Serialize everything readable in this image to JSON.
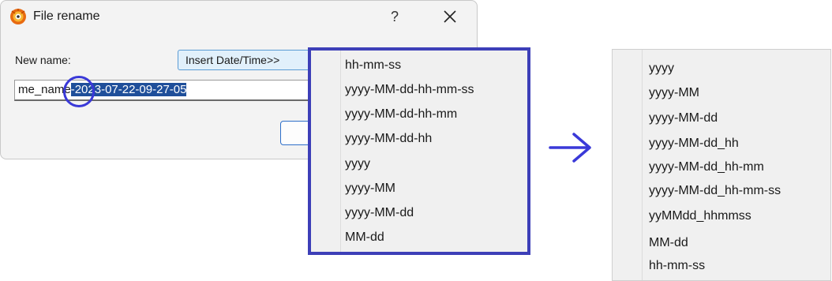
{
  "dialog": {
    "title": "File rename",
    "help_label": "?",
    "new_name_label": "New name:",
    "insert_button_label": "Insert Date/Time>>",
    "name_prefix": "me_name",
    "name_selected": "-2023-07-22-09-27-05"
  },
  "menu_before": {
    "items": [
      "hh-mm-ss",
      "yyyy-MM-dd-hh-mm-ss",
      "yyyy-MM-dd-hh-mm",
      "yyyy-MM-dd-hh",
      "yyyy",
      "yyyy-MM",
      "yyyy-MM-dd",
      "MM-dd"
    ]
  },
  "menu_after": {
    "items": [
      "yyyy",
      "yyyy-MM",
      "yyyy-MM-dd",
      "yyyy-MM-dd_hh",
      "yyyy-MM-dd_hh-mm",
      "yyyy-MM-dd_hh-mm-ss",
      "yyMMdd_hhmmss",
      "MM-dd",
      "hh-mm-ss"
    ]
  },
  "colors": {
    "highlight_border": "#3d3fb8",
    "selection": "#1f4f9a",
    "accent_button": "#e1f0fb"
  },
  "icons": [
    "app-logo-icon",
    "close-icon",
    "right-arrow-icon"
  ]
}
